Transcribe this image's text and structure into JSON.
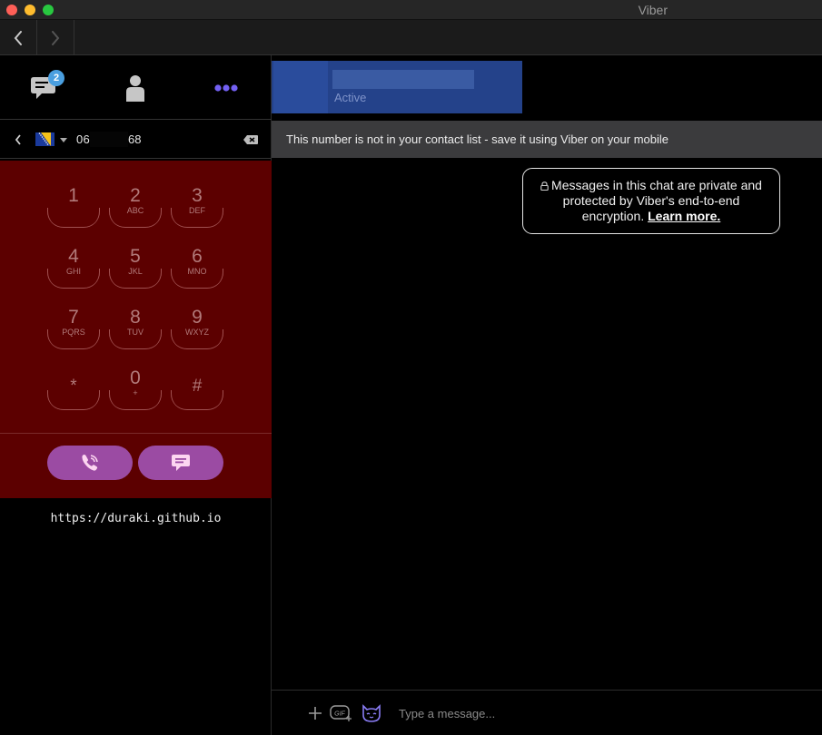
{
  "window": {
    "title": "Viber"
  },
  "sidebar": {
    "tabs": [
      {
        "name": "Chats",
        "icon": "chat-bubble-icon",
        "badge": "2"
      },
      {
        "name": "Contacts",
        "icon": "person-icon"
      },
      {
        "name": "More",
        "icon": "more-dots-icon"
      }
    ],
    "accent_color": "#7360f2"
  },
  "dialer": {
    "country_flag": "flag-bosnia-icon",
    "phone_start": "06",
    "phone_end": "68",
    "keys": [
      {
        "digit": "1",
        "letters": ""
      },
      {
        "digit": "2",
        "letters": "ABC"
      },
      {
        "digit": "3",
        "letters": "DEF"
      },
      {
        "digit": "4",
        "letters": "GHI"
      },
      {
        "digit": "5",
        "letters": "JKL"
      },
      {
        "digit": "6",
        "letters": "MNO"
      },
      {
        "digit": "7",
        "letters": "PQRS"
      },
      {
        "digit": "8",
        "letters": "TUV"
      },
      {
        "digit": "9",
        "letters": "WXYZ"
      },
      {
        "digit": "*",
        "letters": ""
      },
      {
        "digit": "0",
        "letters": "+"
      },
      {
        "digit": "#",
        "letters": ""
      }
    ],
    "background_color": "#5c0000",
    "button_color": "#9b4ba3"
  },
  "footer": {
    "website": "https://duraki.github.io"
  },
  "chat": {
    "contact_status": "Active",
    "notice": "This number is not in your contact list - save it using Viber on your mobile",
    "encryption_text": "Messages in this chat are private and protected by Viber's end-to-end encryption.",
    "learn_more": "Learn more.",
    "composer_placeholder": "Type a message...",
    "gif_label": "GIF"
  }
}
